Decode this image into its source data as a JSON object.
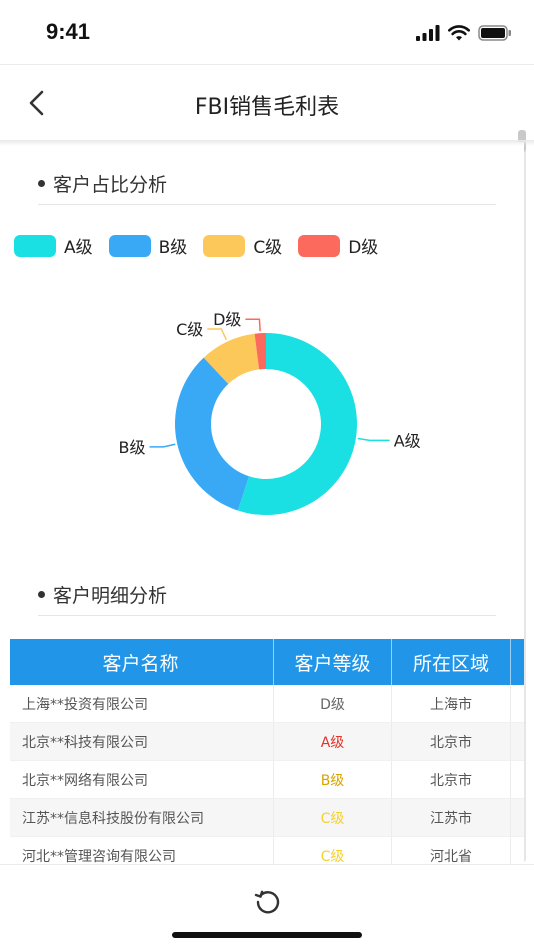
{
  "status": {
    "time": "9:41"
  },
  "nav": {
    "title": "FBI销售毛利表"
  },
  "sections": {
    "share": "客户占比分析",
    "detail": "客户明细分析"
  },
  "legend": [
    {
      "label": "A级",
      "color": "#1ae0e3"
    },
    {
      "label": "B级",
      "color": "#3aa9f5"
    },
    {
      "label": "C级",
      "color": "#fdc85a"
    },
    {
      "label": "D级",
      "color": "#fb6a5c"
    }
  ],
  "chart_data": {
    "type": "pie",
    "categories": [
      "A级",
      "B级",
      "C级",
      "D级"
    ],
    "values": [
      55,
      33,
      10,
      2
    ],
    "colors": [
      "#1ae0e3",
      "#3aa9f5",
      "#fdc85a",
      "#fb6a5c"
    ],
    "donut": true,
    "legend": "top-left"
  },
  "table": {
    "headers": [
      "客户名称",
      "客户等级",
      "所在区域"
    ],
    "rows": [
      {
        "name": "上海**投资有限公司",
        "level": "D级",
        "level_color": "#666666",
        "region": "上海市"
      },
      {
        "name": "北京**科技有限公司",
        "level": "A级",
        "level_color": "#e0352b",
        "region": "北京市"
      },
      {
        "name": "北京**网络有限公司",
        "level": "B级",
        "level_color": "#d9a400",
        "region": "北京市"
      },
      {
        "name": "江苏**信息科技股份有限公司",
        "level": "C级",
        "level_color": "#f5d22e",
        "region": "江苏市"
      },
      {
        "name": "河北**管理咨询有限公司",
        "level": "C级",
        "level_color": "#f5d22e",
        "region": "河北省"
      }
    ]
  }
}
